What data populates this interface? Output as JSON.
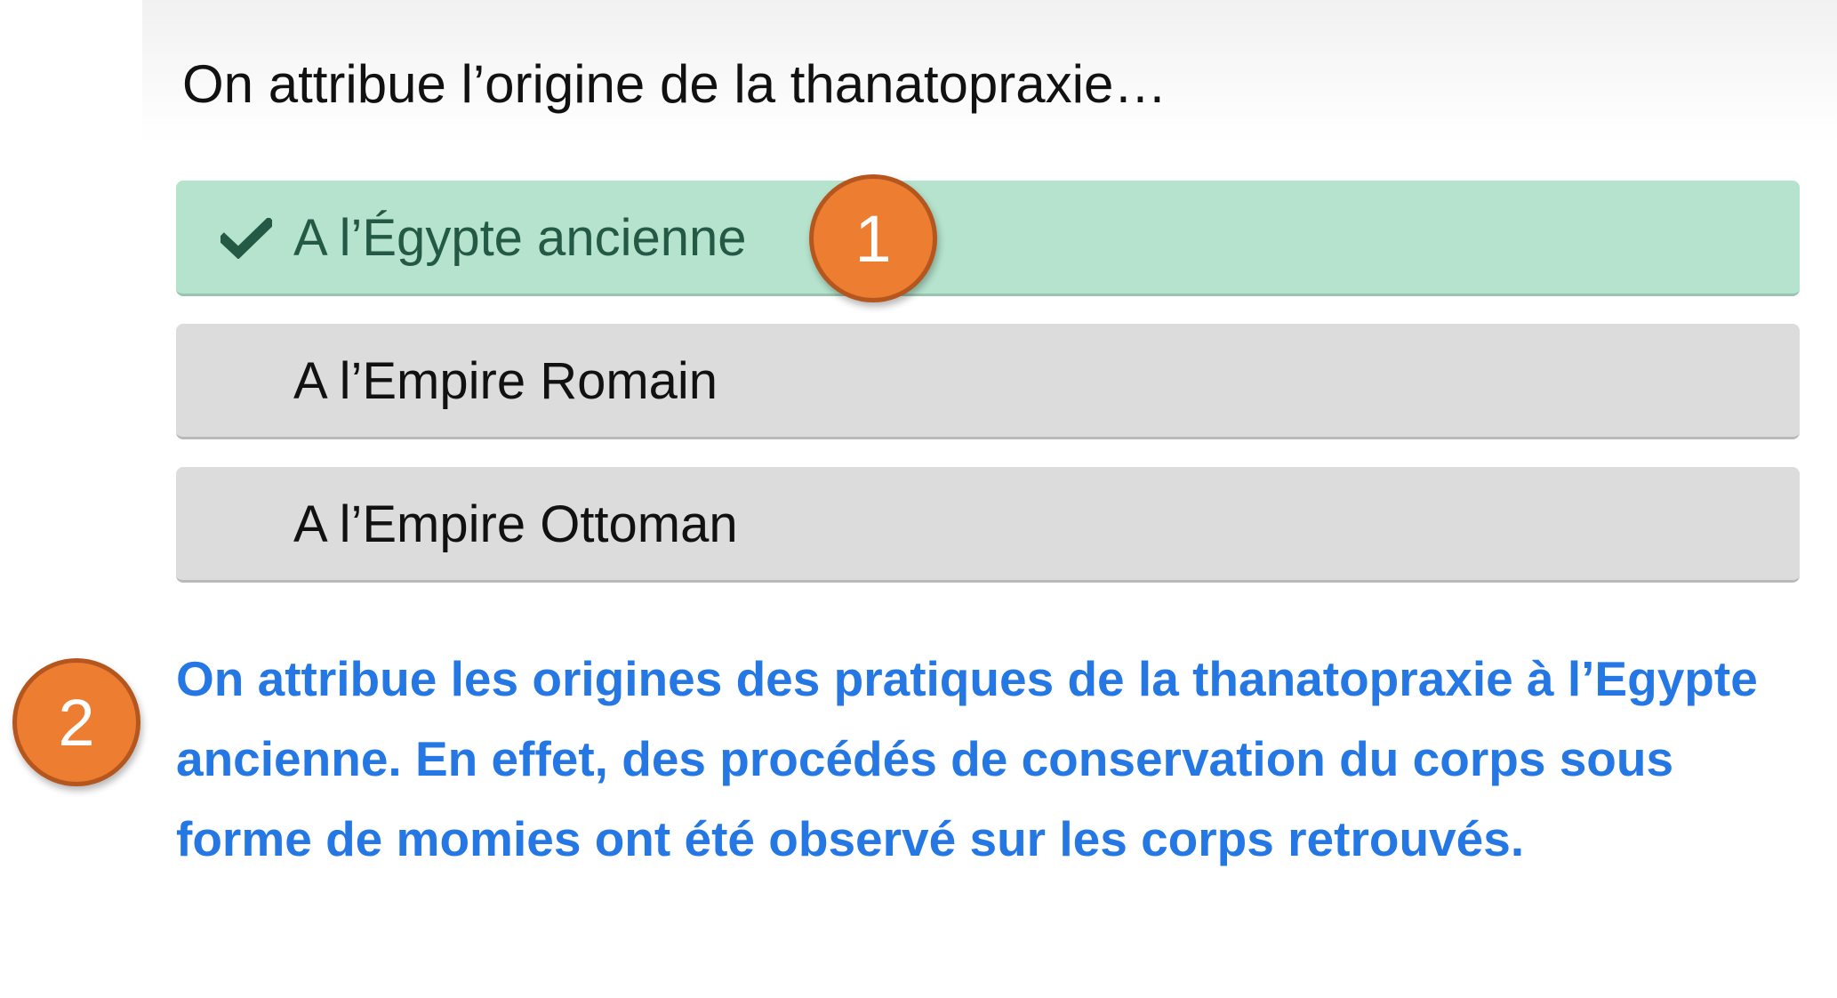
{
  "question": {
    "text": "On attribue l’origine de la thanatopraxie…"
  },
  "options": [
    {
      "label": "A l’Égypte ancienne",
      "correct": true,
      "icon": "check-icon"
    },
    {
      "label": "A l’Empire Romain",
      "correct": false
    },
    {
      "label": "A l’Empire Ottoman",
      "correct": false
    }
  ],
  "explanation": {
    "text": "On attribue les origines des pratiques de la thanatopraxie à l’Egypte ancienne. En effet, des procédés de conservation du corps sous forme de momies ont été observé sur les corps retrouvés."
  },
  "markers": [
    {
      "label": "1"
    },
    {
      "label": "2"
    }
  ],
  "colors": {
    "correct_bg": "#b5e3cd",
    "correct_text": "#245a45",
    "option_bg": "#dcdcdc",
    "explanation_text": "#2577e4",
    "marker_bg": "#ec7d31"
  }
}
